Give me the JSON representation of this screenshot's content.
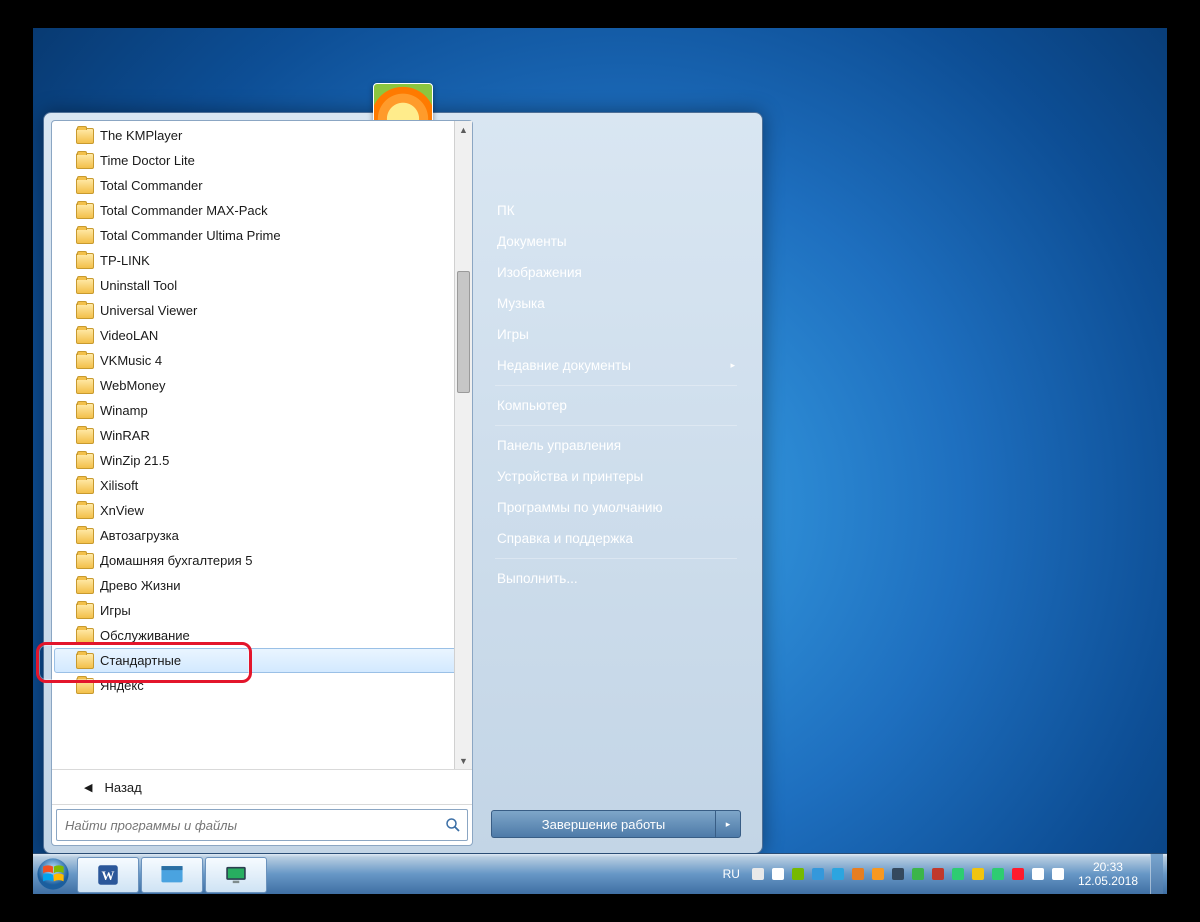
{
  "programs": [
    "The KMPlayer",
    "Time Doctor Lite",
    "Total Commander",
    "Total Commander MAX-Pack",
    "Total Commander Ultima Prime",
    "TP-LINK",
    "Uninstall Tool",
    "Universal Viewer",
    "VideoLAN",
    "VKMusic 4",
    "WebMoney",
    "Winamp",
    "WinRAR",
    "WinZip 21.5",
    "Xilisoft",
    "XnView",
    "Автозагрузка",
    "Домашняя бухгалтерия 5",
    "Древо Жизни",
    "Игры",
    "Обслуживание",
    "Стандартные",
    "Яндекс"
  ],
  "highlighted_index": 21,
  "back_label": "Назад",
  "search_placeholder": "Найти программы и файлы",
  "right_panel": {
    "groups": [
      [
        "ПК",
        "Документы",
        "Изображения",
        "Музыка",
        "Игры",
        "Недавние документы"
      ],
      [
        "Компьютер"
      ],
      [
        "Панель управления",
        "Устройства и принтеры",
        "Программы по умолчанию",
        "Справка и поддержка"
      ],
      [
        "Выполнить..."
      ]
    ],
    "submenu_index": 5
  },
  "shutdown_label": "Завершение работы",
  "taskbar": {
    "lang": "RU",
    "time": "20:33",
    "date": "12.05.2018",
    "tray_icons": [
      {
        "name": "keyboard-icon",
        "color": "#e9e9e9"
      },
      {
        "name": "notify-up-icon",
        "color": "#ffffff"
      },
      {
        "name": "nvidia-icon",
        "color": "#76b900"
      },
      {
        "name": "app-blue-icon",
        "color": "#3498db"
      },
      {
        "name": "telegram-icon",
        "color": "#2ca5e0"
      },
      {
        "name": "app-orange-icon",
        "color": "#e67e22"
      },
      {
        "name": "java-icon",
        "color": "#f89820"
      },
      {
        "name": "disk-icon",
        "color": "#34495e"
      },
      {
        "name": "utorrent-icon",
        "color": "#3cb54a"
      },
      {
        "name": "app-flag-icon",
        "color": "#c0392b"
      },
      {
        "name": "signal-icon",
        "color": "#2ecc71"
      },
      {
        "name": "bolt-icon",
        "color": "#f1c40f"
      },
      {
        "name": "shield-icon",
        "color": "#2ecc71"
      },
      {
        "name": "opera-icon",
        "color": "#ff1b2d"
      },
      {
        "name": "network-icon",
        "color": "#ffffff"
      },
      {
        "name": "volume-icon",
        "color": "#ffffff"
      }
    ]
  }
}
